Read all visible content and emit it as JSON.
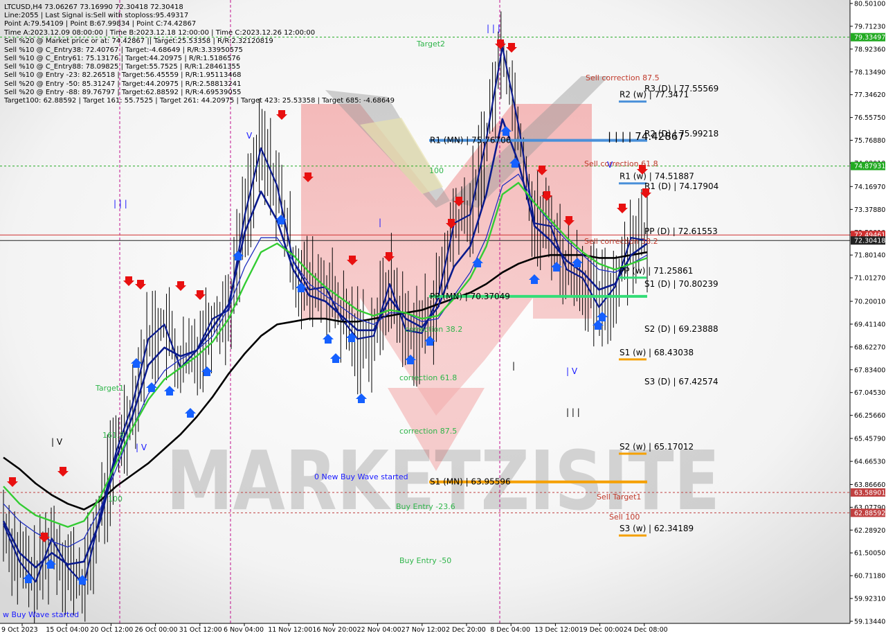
{
  "header": {
    "symbol_line": "LTCUSD,H4  73.06267 73.16990 72.30418 72.30418",
    "info_lines": [
      "Line:2055 | Last Signal is:Sell with stoploss:95.49317",
      "Point A:79.54109 | Point B:67.99834 | Point C:74.42867",
      "Time A:2023.12.09 08:00:00 | Time B:2023.12.18 12:00:00 | Time C:2023.12.26 12:00:00",
      "Sell %20 @ Market price or at: 74.42867 || Target:25.53358 | R/R:2.32120819",
      "Sell %10 @ C_Entry38: 72.40767 | Target:-4.68649 | R/R:3.33950575",
      "Sell %10 @ C_Entry61: 75.13176 | Target:44.20975 | R/R:1.5186576",
      "Sell %10 @ C_Entry88: 78.09825 | Target:55.7525 | R/R:1.28461355",
      "Sell %10 @ Entry -23: 82.26518 | Target:56.45559 | R/R:1.95113468",
      "Sell %20 @ Entry -50: 85.31247 | Target:44.20975 | R/R:2.58813241",
      "Sell %20 @ Entry -88: 89.76797 | Target:62.88592 | R/R:4.69539055",
      "Target100: 62.88592 | Target 161: 55.7525 | Target 261: 44.20975 | Target 423: 25.53358 | Target 685: -4.68649"
    ]
  },
  "price_axis": {
    "ticks": [
      "80.50100",
      "79.71230",
      "78.92360",
      "78.13490",
      "77.34620",
      "76.55750",
      "75.76880",
      "74.98010",
      "74.16970",
      "73.37880",
      "72.59010",
      "71.80140",
      "71.01270",
      "70.20010",
      "69.41140",
      "68.62270",
      "67.83400",
      "67.04530",
      "66.25660",
      "65.45790",
      "64.66530",
      "63.86660",
      "63.07790",
      "62.28920",
      "61.50050",
      "60.71180",
      "59.92310",
      "59.13440"
    ],
    "range": [
      59.1344,
      80.501
    ],
    "badges": [
      {
        "text": "79.33497",
        "value": 79.33497,
        "color": "#22aa22"
      },
      {
        "text": "74.87931",
        "value": 74.87931,
        "color": "#22aa22"
      },
      {
        "text": "72.49461",
        "value": 72.49461,
        "color": "#d03030"
      },
      {
        "text": "72.30418",
        "value": 72.30418,
        "color": "#222222"
      },
      {
        "text": "63.58901",
        "value": 63.58901,
        "color": "#c04040"
      },
      {
        "text": "62.88592",
        "value": 62.88592,
        "color": "#c04040"
      }
    ]
  },
  "time_axis": {
    "labels": [
      "9 Oct 2023",
      "15 Oct 04:00",
      "20 Oct 12:00",
      "26 Oct 00:00",
      "31 Oct 12:00",
      "6 Nov 04:00",
      "11 Nov 12:00",
      "16 Nov 20:00",
      "22 Nov 04:00",
      "27 Nov 12:00",
      "2 Dec 20:00",
      "8 Dec 04:00",
      "13 Dec 12:00",
      "19 Dec 00:00",
      "24 Dec 08:00"
    ]
  },
  "levels": [
    {
      "id": "r3-d",
      "text": "R3 (D) | 77.55569",
      "value": 77.55569,
      "color": "",
      "seg": null
    },
    {
      "id": "r2-w",
      "text": "R2 (w) | 77.3471",
      "value": 77.3471,
      "color": "#4a90d9",
      "seg": "short"
    },
    {
      "id": "r2-d",
      "text": "R2 (D) | 75.99218",
      "value": 75.99218,
      "color": "",
      "seg": null
    },
    {
      "id": "r1-mn",
      "text": "R1 (MN) | 75.76706",
      "value": 75.76706,
      "color": "#4a90d9",
      "seg": "long"
    },
    {
      "id": "r1-w",
      "text": "R1 (w) | 74.51887",
      "value": 74.51887,
      "color": "#4a90d9",
      "seg": "short"
    },
    {
      "id": "r1-d",
      "text": "R1 (D) | 74.17904",
      "value": 74.17904,
      "color": "",
      "seg": null
    },
    {
      "id": "pp-d",
      "text": "PP (D) | 72.61553",
      "value": 72.61553,
      "color": "",
      "seg": null
    },
    {
      "id": "pp-w",
      "text": "PP (w) | 71.25861",
      "value": 71.25861,
      "color": "#33dd77",
      "seg": "short"
    },
    {
      "id": "s1-d",
      "text": "S1 (D) | 70.80239",
      "value": 70.80239,
      "color": "",
      "seg": null
    },
    {
      "id": "pp-mn",
      "text": "PP (MN) | 70.37049",
      "value": 70.37049,
      "color": "#33dd77",
      "seg": "long"
    },
    {
      "id": "s2-d",
      "text": "S2 (D) | 69.23888",
      "value": 69.23888,
      "color": "",
      "seg": null
    },
    {
      "id": "s1-w",
      "text": "S1 (w) | 68.43038",
      "value": 68.43038,
      "color": "#f5a000",
      "seg": "short"
    },
    {
      "id": "s3-d",
      "text": "S3 (D) | 67.42574",
      "value": 67.42574,
      "color": "",
      "seg": null
    },
    {
      "id": "s2-w",
      "text": "S2 (w) | 65.17012",
      "value": 65.17012,
      "color": "#f5a000",
      "seg": "short"
    },
    {
      "id": "s1-mn",
      "text": "S1 (MN) | 63.95596",
      "value": 63.95596,
      "color": "#f5a000",
      "seg": "long"
    },
    {
      "id": "s3-w",
      "text": "S3 (w) | 62.34189",
      "value": 62.34189,
      "color": "#f5a000",
      "seg": "short"
    }
  ],
  "annotations": {
    "point_c": "| | | | 74.42867",
    "target2": "Target2",
    "target1": "Target1",
    "sell_correction_875": "Sell correction 87.5",
    "sell_correction_618": "Sell correction 61.8",
    "sell_correction_382": "Sell correction 38.2",
    "hundred_top": "100",
    "correction_382": "correction 38.2",
    "correction_618": "correction 61.8",
    "correction_875": "correction 87.5",
    "new_buy_wave": "0 New Buy Wave started",
    "buy_wave_left": "w Buy Wave started",
    "buy_entry_236": "Buy Entry -23.6",
    "buy_entry_50": "Buy Entry -50",
    "sell_target1": "Sell Target1",
    "sell_100": "Sell 100",
    "hundred_left": "100",
    "one_six_one": "161.8",
    "wave_labels": [
      "| | |",
      "| V",
      "| V",
      "V",
      "|",
      "| | |",
      "| V",
      "| | |",
      "V",
      "|",
      "| |"
    ]
  },
  "watermark": "MARKETZISITE",
  "colors": {
    "ma_black": "#000000",
    "ma_navy": "#0a1a8c",
    "ma_blue": "#1f2fbf",
    "ma_green": "#33cc33",
    "candle": "#000000",
    "buy_arrow": "#1560ff",
    "sell_arrow": "#e81010"
  },
  "chart_data": {
    "type": "line",
    "title": "LTCUSD,H4",
    "ylim": [
      59.1344,
      80.501
    ],
    "x_labels": [
      "9 Oct 2023",
      "15 Oct 04:00",
      "20 Oct 12:00",
      "26 Oct 00:00",
      "31 Oct 12:00",
      "6 Nov 04:00",
      "11 Nov 12:00",
      "16 Nov 20:00",
      "22 Nov 04:00",
      "27 Nov 12:00",
      "2 Dec 20:00",
      "8 Dec 04:00",
      "13 Dec 12:00",
      "19 Dec 00:00",
      "24 Dec 08:00"
    ],
    "series": [
      {
        "values": [
          62.5,
          61.2,
          60.5,
          62.0,
          61.0,
          60.4,
          62.8,
          65.0,
          66.6,
          68.9,
          69.4,
          67.9,
          68.5,
          69.6,
          69.9,
          73.2,
          75.5,
          74.2,
          71.6,
          70.6,
          70.7,
          69.6,
          68.9,
          69.0,
          70.8,
          69.2,
          69.1,
          70.3,
          72.9,
          73.2,
          75.8,
          79.0,
          76.3,
          72.9,
          72.8,
          71.3,
          71.0,
          70.0,
          70.7,
          72.4,
          72.3
        ]
      },
      {
        "values": [
          64.8,
          64.4,
          63.9,
          63.5,
          63.2,
          63.0,
          63.3,
          63.8,
          64.2,
          64.6,
          65.1,
          65.6,
          66.2,
          66.9,
          67.7,
          68.4,
          69.0,
          69.4,
          69.5,
          69.6,
          69.6,
          69.5,
          69.5,
          69.6,
          69.7,
          69.8,
          69.9,
          70.1,
          70.3,
          70.5,
          70.8,
          71.2,
          71.5,
          71.7,
          71.8,
          71.8,
          71.8,
          71.7,
          71.7,
          71.8,
          71.9
        ]
      },
      {
        "values": [
          63.2,
          62.6,
          62.2,
          61.9,
          61.7,
          62.0,
          63.0,
          64.4,
          65.8,
          67.0,
          67.8,
          68.2,
          68.5,
          69.0,
          70.0,
          71.4,
          72.4,
          72.4,
          71.6,
          70.8,
          70.4,
          70.0,
          69.6,
          69.4,
          69.8,
          69.8,
          69.5,
          69.6,
          70.4,
          71.2,
          72.4,
          74.2,
          74.6,
          73.6,
          72.9,
          72.3,
          71.8,
          71.3,
          71.2,
          71.5,
          71.8
        ]
      },
      {
        "values": [
          62.6,
          61.5,
          61.0,
          61.5,
          61.1,
          61.2,
          62.6,
          64.8,
          66.2,
          68.0,
          68.6,
          68.3,
          68.5,
          69.3,
          70.1,
          72.6,
          74.0,
          73.0,
          71.3,
          70.4,
          70.2,
          69.7,
          69.2,
          69.2,
          70.3,
          69.6,
          69.3,
          70.0,
          71.4,
          72.1,
          73.9,
          76.5,
          75.0,
          72.8,
          72.3,
          71.6,
          71.2,
          70.6,
          70.8,
          71.8,
          72.2
        ]
      },
      {
        "values": [
          63.8,
          63.2,
          62.8,
          62.6,
          62.4,
          62.6,
          63.4,
          64.6,
          65.8,
          66.8,
          67.5,
          67.9,
          68.3,
          68.8,
          69.6,
          70.8,
          71.9,
          72.2,
          71.8,
          71.2,
          70.7,
          70.3,
          69.9,
          69.7,
          69.9,
          69.8,
          69.6,
          69.7,
          70.3,
          71.0,
          72.1,
          73.9,
          74.3,
          73.6,
          73.0,
          72.4,
          71.9,
          71.5,
          71.3,
          71.5,
          71.7
        ]
      }
    ]
  }
}
